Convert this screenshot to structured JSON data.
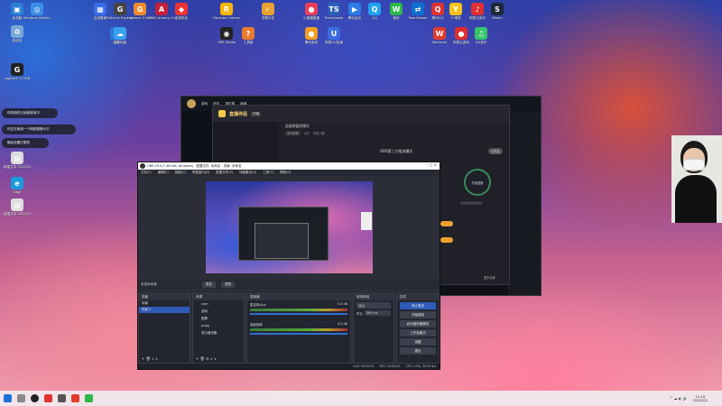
{
  "desktop_icons": [
    {
      "label": "此电脑",
      "color": "#2a7fd4",
      "glyph": "▣"
    },
    {
      "label": "Windows\nDesktop",
      "color": "#3b8ee6",
      "glyph": "◎"
    },
    {
      "label": "回收站",
      "color": "#7aa7d8",
      "glyph": "♻"
    },
    {
      "label": "应用管家",
      "color": "#3a6ee8",
      "glyph": "▦"
    },
    {
      "label": "GeForce\nExperience",
      "color": "#444",
      "glyph": "G"
    },
    {
      "label": "Logitech G\nHUB",
      "color": "#f08a2b",
      "glyph": "G"
    },
    {
      "label": "ASUS Armory\nCrate",
      "color": "#c3203a",
      "glyph": "A"
    },
    {
      "label": "电竞助手",
      "color": "#e33",
      "glyph": "◆"
    },
    {
      "label": "Rockstar\nGames",
      "color": "#f5b500",
      "glyph": "R"
    },
    {
      "label": "学霸中控",
      "color": "#e8a030",
      "glyph": "✓"
    },
    {
      "label": "小鹅通直播",
      "color": "#e93f5a",
      "glyph": "●"
    },
    {
      "label": "TeamSpeak",
      "color": "#2b5fb8",
      "glyph": "TS"
    },
    {
      "label": "腾讯会议",
      "color": "#2e7be6",
      "glyph": "▶"
    },
    {
      "label": "QQ",
      "color": "#1ea3f0",
      "glyph": "Q"
    },
    {
      "label": "微信",
      "color": "#2fb84a",
      "glyph": "W"
    },
    {
      "label": "TeamViewer",
      "color": "#0e6fd1",
      "glyph": "⇄"
    },
    {
      "label": "腾讯QQ",
      "color": "#d33",
      "glyph": "Q"
    },
    {
      "label": "YY语音",
      "color": "#f4c21c",
      "glyph": "Y"
    },
    {
      "label": "网易云音乐",
      "color": "#e02f2f",
      "glyph": "♪"
    },
    {
      "label": "Steam",
      "color": "#1b2838",
      "glyph": "S"
    },
    {
      "label": "WeGame",
      "color": "#e23c2c",
      "glyph": "W"
    },
    {
      "label": "OBS Studio",
      "color": "#222",
      "glyph": "◉"
    },
    {
      "label": "工具箱",
      "color": "#e97a2e",
      "glyph": "?"
    },
    {
      "label": "腾讯游戏",
      "color": "#f0a020",
      "glyph": "●"
    },
    {
      "label": "网易UU加速",
      "color": "#3a6de0",
      "glyph": "U"
    },
    {
      "label": "网易云游戏",
      "color": "#e02f2f",
      "glyph": "●"
    },
    {
      "label": "QQ音乐",
      "color": "#35c46a",
      "glyph": "♫"
    },
    {
      "label": "迅雷",
      "color": "#2e78e0",
      "glyph": "⚡"
    },
    {
      "label": "百度网盘",
      "color": "#37a2f0",
      "glyph": "☁"
    },
    {
      "label": "Edge",
      "color": "#1b9ae0",
      "glyph": "e"
    },
    {
      "label": "新建文本\n2022/01",
      "color": "#ddd",
      "glyph": "▤"
    },
    {
      "label": "新建文本\n2022/01",
      "color": "#ddd",
      "glyph": "▤"
    },
    {
      "label": "Logitech G\nHUB",
      "color": "#222",
      "glyph": "G"
    }
  ],
  "toasts": [
    "你的相机已经被使用中",
    "你正在使用一个网络摄像头中",
    "隐私设置已更改"
  ],
  "bg_window": {
    "title": "LoL",
    "menu": [
      "游戏",
      "好友",
      "排位赛",
      "商城"
    ]
  },
  "live_app": {
    "title": "直播伴侣",
    "badge": "开播",
    "room_title": "英雄联盟直播间",
    "meta": [
      "游戏直播",
      "大厅",
      "在线人数"
    ],
    "subtitle": "OBS第三方推流模式",
    "toggle": "已开启",
    "circle_label": "开始直播",
    "circle_hint": "请先配置推流地址",
    "bottom": "更多设置"
  },
  "obs": {
    "title": "OBS 29.0.2 (64-bit, windows) - 配置文件: 未命名 - 场景: 未命名",
    "menu": [
      "文件(F)",
      "编辑(E)",
      "视图(V)",
      "停靠窗口(D)",
      "配置文件(P)",
      "场景集合(S)",
      "工具(T)",
      "帮助(H)"
    ],
    "no_source": "未选择来源",
    "btn_props": "属性",
    "btn_filters": "滤镜",
    "scenes_header": "场景",
    "scenes": [
      "场景",
      "场景 2"
    ],
    "sources_header": "来源",
    "sources": [
      "cam",
      "游戏",
      "图像",
      "pubg",
      "显示器采集"
    ],
    "mixer_header": "混音器",
    "mixer": [
      {
        "name": "麦克风/Aux",
        "db": "0.0 dB"
      },
      {
        "name": "桌面音频",
        "db": "0.0 dB"
      }
    ],
    "trans_header": "转场特效",
    "trans_type": "淡出",
    "trans_dur_label": "时长",
    "trans_dur": "300 ms",
    "controls_header": "控件",
    "controls": [
      "停止推流",
      "开始录制",
      "启动虚拟摄像机",
      "工作室模式",
      "设置",
      "退出"
    ],
    "status": {
      "live": "LIVE: 00:00:00",
      "rec": "REC: 00:00:00",
      "cpu": "CPU: 0.9%, 30.00 fps"
    }
  },
  "taskbar": {
    "time": "11:10",
    "date": "2022/3/22"
  }
}
